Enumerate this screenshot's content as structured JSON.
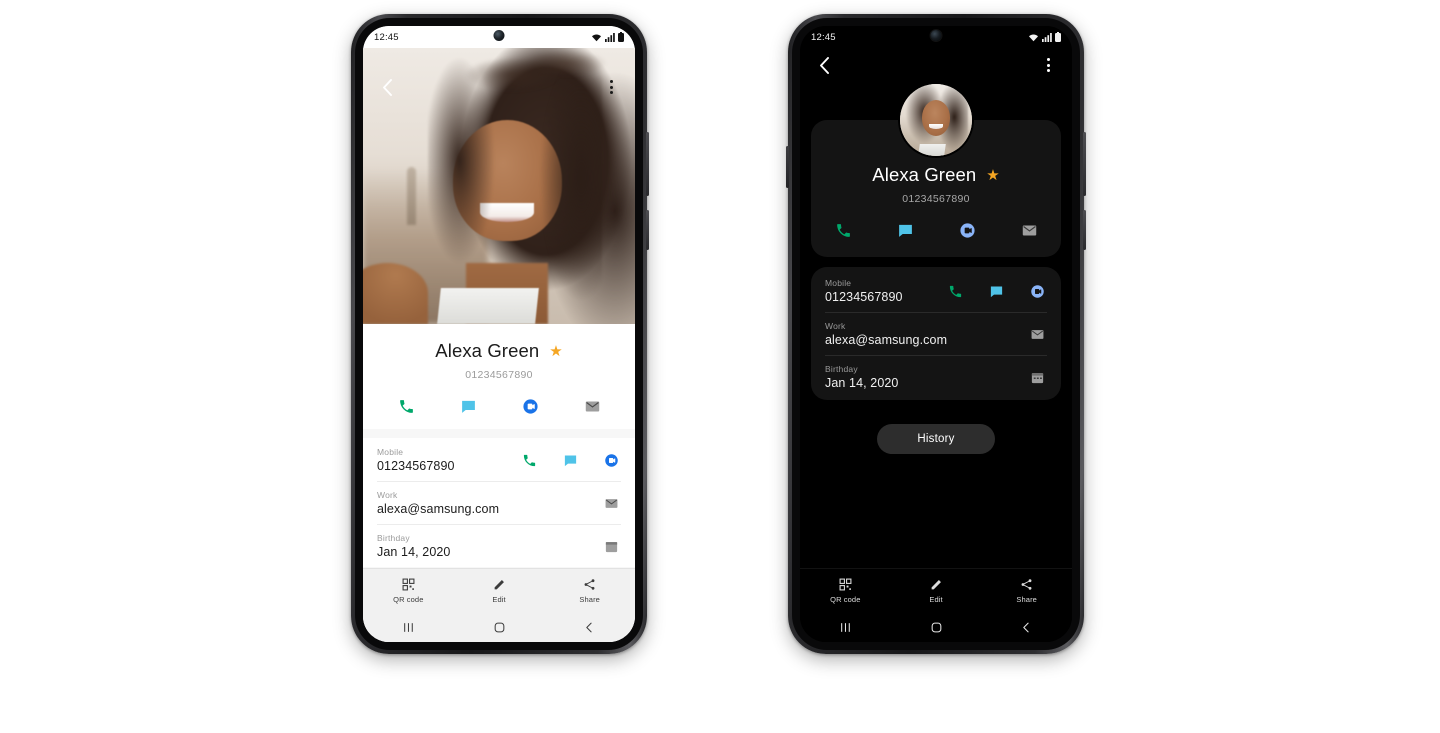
{
  "status_bar": {
    "time": "12:45",
    "icons": [
      "wifi-icon",
      "signal-icon",
      "battery-icon"
    ]
  },
  "app_bar": {
    "back": "back-icon",
    "more": "more-options-icon"
  },
  "contact": {
    "name": "Alexa Green",
    "number": "01234567890",
    "favorite_star": "★",
    "quick_actions": [
      {
        "name": "call-action",
        "icon": "phone-icon",
        "color": "#00A86B"
      },
      {
        "name": "message-action",
        "icon": "message-icon",
        "color": "#4FC3E8"
      },
      {
        "name": "video-call-action",
        "icon": "duo-video-icon",
        "color": "#1A73E8"
      },
      {
        "name": "email-action",
        "icon": "envelope-icon",
        "color": "#9E9E9E"
      }
    ],
    "details": [
      {
        "label": "Mobile",
        "value": "01234567890",
        "actions": [
          {
            "name": "row-call-icon",
            "icon": "phone-icon",
            "color": "#00A86B"
          },
          {
            "name": "row-message-icon",
            "icon": "message-icon",
            "color": "#4FC3E8"
          },
          {
            "name": "row-video-icon",
            "icon": "duo-video-icon",
            "color": "#1A73E8"
          }
        ]
      },
      {
        "label": "Work",
        "value": "alexa@samsung.com",
        "actions": [
          {
            "name": "row-email-icon",
            "icon": "envelope-icon",
            "color": "#9E9E9E"
          }
        ]
      },
      {
        "label": "Birthday",
        "value": "Jan 14, 2020",
        "actions": [
          {
            "name": "row-calendar-icon",
            "icon": "calendar-icon",
            "color": "#9E9E9E"
          }
        ]
      }
    ]
  },
  "dark_theme": {
    "quick_action_video_color": "#8AB4F8",
    "history_label": "History",
    "card_background": "#141414",
    "screen_background": "#000000"
  },
  "toolbar": {
    "items": [
      {
        "label": "QR code",
        "icon": "qr-code-icon"
      },
      {
        "label": "Edit",
        "icon": "pencil-edit-icon"
      },
      {
        "label": "Share",
        "icon": "share-icon"
      }
    ]
  },
  "nav_bar": {
    "items": [
      {
        "name": "recents-nav",
        "icon": "recents-icon"
      },
      {
        "name": "home-nav",
        "icon": "home-icon"
      },
      {
        "name": "back-nav",
        "icon": "back-nav-icon"
      }
    ]
  },
  "colors": {
    "star": "#F5A623",
    "phone_green": "#00A86B",
    "message_blue": "#4FC3E8",
    "duo_blue": "#1A73E8",
    "envelope_gray": "#9E9E9E"
  }
}
